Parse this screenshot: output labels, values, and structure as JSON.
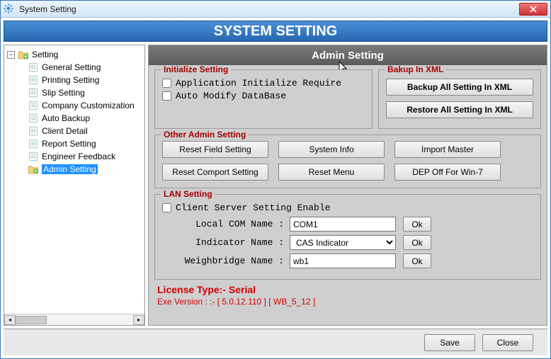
{
  "window": {
    "title": "System Setting"
  },
  "header": {
    "title": "SYSTEM SETTING"
  },
  "tree": {
    "root": "Setting",
    "items": [
      "General Setting",
      "Printing Setting",
      "Slip Setting",
      "Company Customization",
      "Auto Backup",
      "Client Detail",
      "Report Setting",
      "Engineer Feedback",
      "Admin Setting"
    ],
    "selected_index": 8
  },
  "section": {
    "title": "Admin Setting"
  },
  "initialize": {
    "legend": "Initialize Setting",
    "chk1": "Application Initialize Require",
    "chk2": "Auto Modify DataBase"
  },
  "backup": {
    "legend": "Bakup In XML",
    "btn1": "Backup All Setting In XML",
    "btn2": "Restore All Setting In XML"
  },
  "other": {
    "legend": "Other Admin Setting",
    "b1": "Reset Field Setting",
    "b2": "System Info",
    "b3": "Import Master",
    "b4": "Reset Comport Setting",
    "b5": "Reset Menu",
    "b6": "DEP Off For Win-7"
  },
  "lan": {
    "legend": "LAN Setting",
    "chk": "Client Server Setting Enable",
    "l1": "Local COM Name :",
    "v1": "COM1",
    "l2": "Indicator Name :",
    "v2": "CAS Indicator",
    "l3": "Weighbridge Name :",
    "v3": "wb1",
    "ok": "Ok"
  },
  "license": {
    "l1": "License Type:- Serial",
    "l2": "Exe Version : :-  [ 5.0.12.110 ] [ WB_5_12 ]"
  },
  "footer": {
    "save": "Save",
    "close": "Close"
  }
}
